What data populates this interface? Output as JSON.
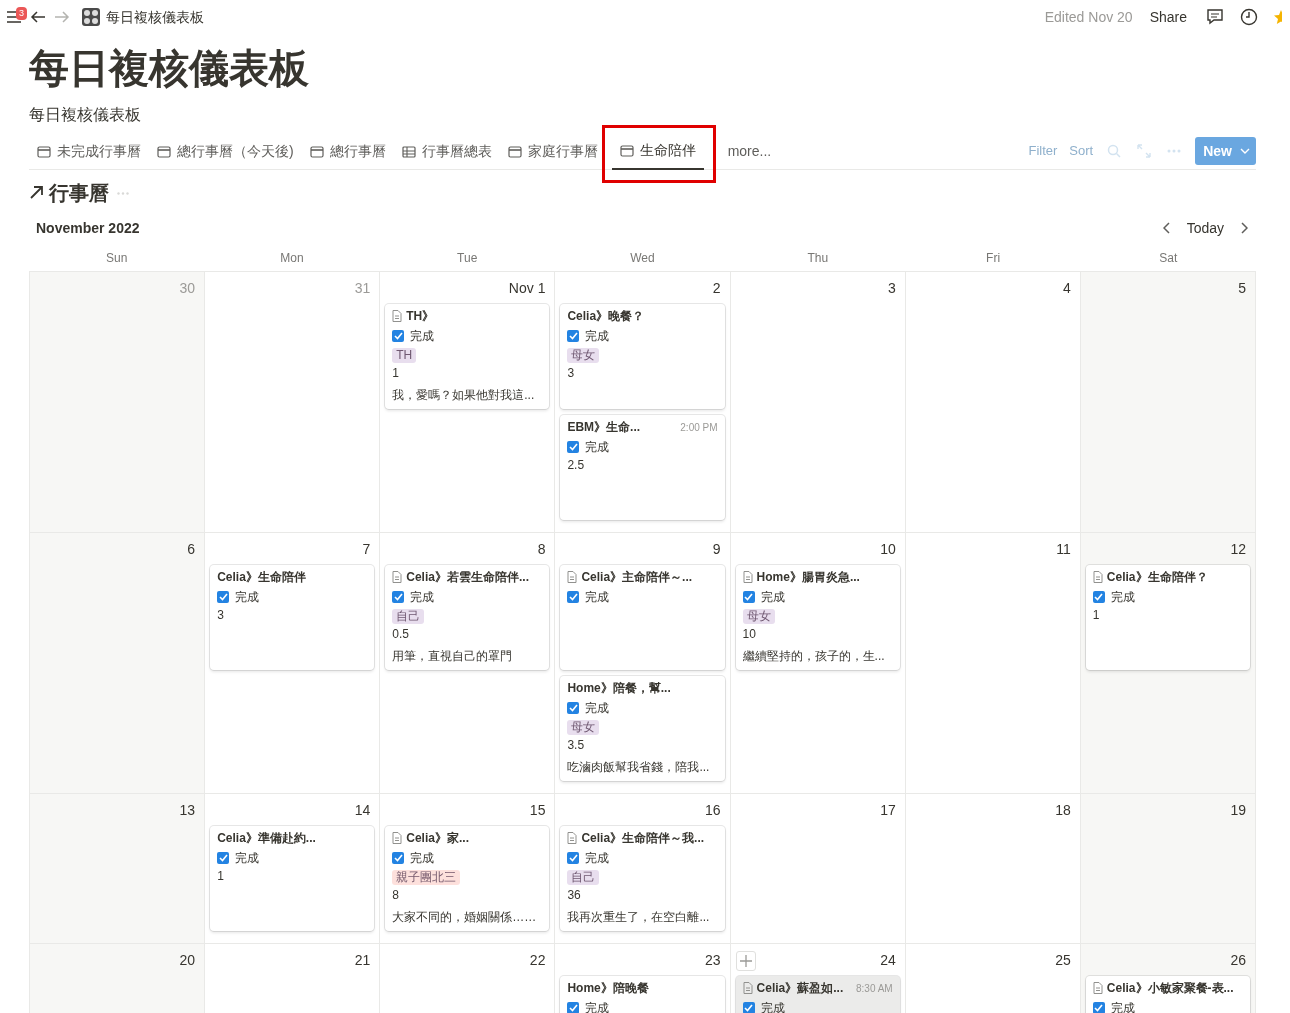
{
  "topbar": {
    "notification_count": "3",
    "breadcrumb": "每日複核儀表板",
    "edited": "Edited Nov 20",
    "share": "Share"
  },
  "title": "每日複核儀表板",
  "description": "每日複核儀表板",
  "views": [
    {
      "label": "未完成行事曆",
      "kind": "calendar",
      "selected": false,
      "annotated": false
    },
    {
      "label": "總行事曆（今天後)",
      "kind": "calendar",
      "selected": false,
      "annotated": false
    },
    {
      "label": "總行事曆",
      "kind": "calendar",
      "selected": false,
      "annotated": false
    },
    {
      "label": "行事曆總表",
      "kind": "table",
      "selected": false,
      "annotated": false
    },
    {
      "label": "家庭行事曆",
      "kind": "calendar",
      "selected": false,
      "annotated": false
    },
    {
      "label": "生命陪伴",
      "kind": "calendar",
      "selected": true,
      "annotated": true
    }
  ],
  "more": "more...",
  "toolbar": {
    "filter": "Filter",
    "sort": "Sort",
    "new": "New"
  },
  "calendar": {
    "title": "行事曆",
    "month": "November 2022",
    "today": "Today",
    "weekdays": [
      "Sun",
      "Mon",
      "Tue",
      "Wed",
      "Thu",
      "Fri",
      "Sat"
    ],
    "weeks": [
      {
        "days": [
          {
            "label": "30",
            "muted": true,
            "add_button": false
          },
          {
            "label": "31",
            "muted": true,
            "add_button": false
          },
          {
            "label": "Nov 1",
            "muted": false,
            "add_button": false,
            "cards": [
              {
                "title": "TH》",
                "page_icon": true,
                "checked": true,
                "status": "完成",
                "tag": {
                  "text": "TH",
                  "color": "#e8deee"
                },
                "value": "1",
                "note": "我，愛嗎？如果他對我這...",
                "hovered": false
              }
            ]
          },
          {
            "label": "2",
            "muted": false,
            "add_button": false,
            "cards": [
              {
                "title": "Celia》晚餐？",
                "page_icon": false,
                "checked": true,
                "status": "完成",
                "tag": {
                  "text": "母女",
                  "color": "#e8deee"
                },
                "value": "3",
                "hovered": false
              },
              {
                "title": "EBM》生命...",
                "page_icon": false,
                "time": "2:00 PM",
                "checked": true,
                "status": "完成",
                "value": "2.5",
                "hovered": false
              }
            ]
          },
          {
            "label": "3",
            "muted": false,
            "add_button": false
          },
          {
            "label": "4",
            "muted": false,
            "add_button": false
          },
          {
            "label": "5",
            "muted": false,
            "add_button": false
          }
        ]
      },
      {
        "days": [
          {
            "label": "6",
            "muted": false,
            "add_button": false
          },
          {
            "label": "7",
            "muted": false,
            "add_button": false,
            "cards": [
              {
                "title": "Celia》生命陪伴",
                "page_icon": false,
                "checked": true,
                "status": "完成",
                "value": "3",
                "hovered": false
              }
            ]
          },
          {
            "label": "8",
            "muted": false,
            "add_button": false,
            "cards": [
              {
                "title": "Celia》若雲生命陪伴...",
                "page_icon": true,
                "checked": true,
                "status": "完成",
                "tag": {
                  "text": "自己",
                  "color": "#e8deee"
                },
                "value": "0.5",
                "note": "用筆，直視自己的罩門",
                "hovered": false
              }
            ]
          },
          {
            "label": "9",
            "muted": false,
            "add_button": false,
            "cards": [
              {
                "title": "Celia》主命陪伴～...",
                "page_icon": true,
                "checked": true,
                "status": "完成",
                "hovered": false
              },
              {
                "title": "Home》陪餐，幫...",
                "page_icon": false,
                "checked": true,
                "status": "完成",
                "tag": {
                  "text": "母女",
                  "color": "#e8deee"
                },
                "value": "3.5",
                "note": "吃滷肉飯幫我省錢，陪我...",
                "hovered": false
              }
            ]
          },
          {
            "label": "10",
            "muted": false,
            "add_button": false,
            "cards": [
              {
                "title": "Home》腸胃炎急...",
                "page_icon": true,
                "checked": true,
                "status": "完成",
                "tag": {
                  "text": "母女",
                  "color": "#e8deee"
                },
                "value": "10",
                "note": "繼續堅持的，孩子的，生...",
                "hovered": false
              }
            ]
          },
          {
            "label": "11",
            "muted": false,
            "add_button": false
          },
          {
            "label": "12",
            "muted": false,
            "add_button": false,
            "cards": [
              {
                "title": "Celia》生命陪伴？",
                "page_icon": true,
                "checked": true,
                "status": "完成",
                "value": "1",
                "hovered": false
              }
            ]
          }
        ]
      },
      {
        "days": [
          {
            "label": "13",
            "muted": false,
            "add_button": false
          },
          {
            "label": "14",
            "muted": false,
            "add_button": false,
            "cards": [
              {
                "title": "Celia》準備赴約...",
                "page_icon": false,
                "checked": true,
                "status": "完成",
                "value": "1",
                "hovered": false
              }
            ]
          },
          {
            "label": "15",
            "muted": false,
            "add_button": false,
            "cards": [
              {
                "title": "Celia》家...",
                "page_icon": true,
                "checked": true,
                "status": "完成",
                "tag": {
                  "text": "親子團北三",
                  "color": "#fde0dc"
                },
                "value": "8",
                "note": "大家不同的，婚姻關係……",
                "hovered": false
              }
            ]
          },
          {
            "label": "16",
            "muted": false,
            "add_button": false,
            "cards": [
              {
                "title": "Celia》生命陪伴～我...",
                "page_icon": true,
                "checked": true,
                "status": "完成",
                "tag": {
                  "text": "自己",
                  "color": "#e8deee"
                },
                "value": "36",
                "note": "我再次重生了，在空白離...",
                "hovered": false
              }
            ]
          },
          {
            "label": "17",
            "muted": false,
            "add_button": false
          },
          {
            "label": "18",
            "muted": false,
            "add_button": false
          },
          {
            "label": "19",
            "muted": false,
            "add_button": false
          }
        ]
      },
      {
        "days": [
          {
            "label": "20",
            "muted": false,
            "add_button": false
          },
          {
            "label": "21",
            "muted": false,
            "add_button": false
          },
          {
            "label": "22",
            "muted": false,
            "add_button": false
          },
          {
            "label": "23",
            "muted": false,
            "add_button": false,
            "cards": [
              {
                "title": "Home》陪晚餐",
                "page_icon": false,
                "checked": true,
                "status": "完成",
                "hovered": false
              }
            ]
          },
          {
            "label": "24",
            "muted": false,
            "add_button": true,
            "cards": [
              {
                "title": "Celia》蘇盈如...",
                "page_icon": true,
                "time": "8:30 AM",
                "checked": true,
                "status": "完成",
                "hovered": true
              }
            ]
          },
          {
            "label": "25",
            "muted": false,
            "add_button": false
          },
          {
            "label": "26",
            "muted": false,
            "add_button": false,
            "cards": [
              {
                "title": "Celia》小敏家聚餐-表...",
                "page_icon": true,
                "checked": true,
                "status": "完成",
                "hovered": false
              }
            ]
          }
        ]
      }
    ]
  }
}
